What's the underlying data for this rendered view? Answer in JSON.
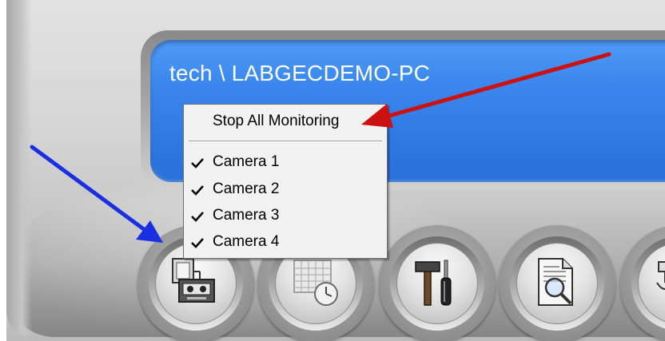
{
  "display": {
    "title": "tech \\ LABGECDEMO-PC"
  },
  "context_menu": {
    "stop_label": "Stop All Monitoring",
    "items": [
      {
        "label": "Camera 1",
        "checked": true
      },
      {
        "label": "Camera 2",
        "checked": true
      },
      {
        "label": "Camera 3",
        "checked": true
      },
      {
        "label": "Camera 4",
        "checked": true
      }
    ]
  },
  "toolbar": {
    "buttons": [
      {
        "icon": "monitor-recorder-icon"
      },
      {
        "icon": "calendar-clock-icon"
      },
      {
        "icon": "hammer-screwdriver-icon"
      },
      {
        "icon": "document-search-icon"
      },
      {
        "icon": "network-icon"
      }
    ]
  },
  "colors": {
    "display_blue": "#3b88ee",
    "annotation_red": "#cc1111",
    "annotation_blue": "#1a2fe0"
  }
}
